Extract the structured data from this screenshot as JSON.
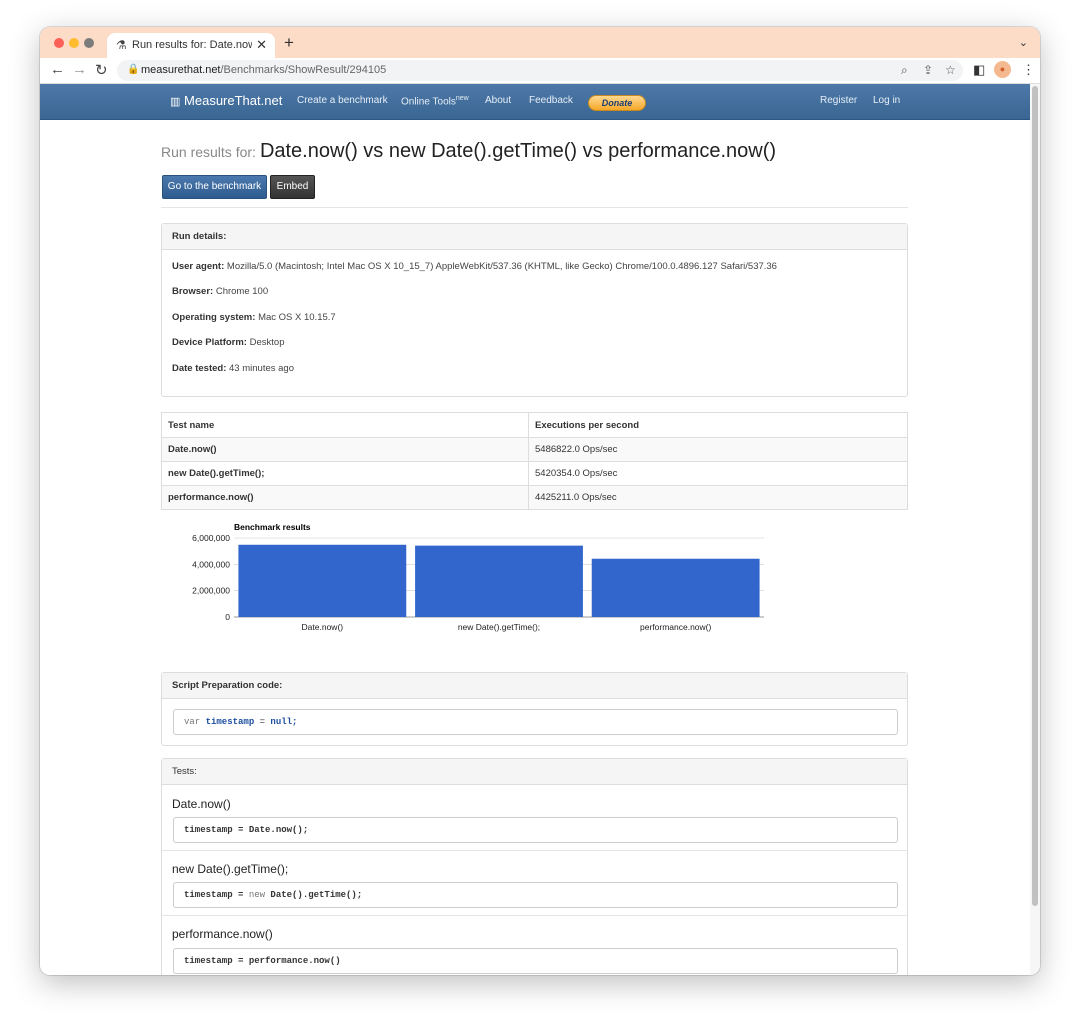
{
  "browser": {
    "tab_title": "Run results for: Date.now() vs n",
    "url_domain": "measurethat.net",
    "url_path": "/Benchmarks/ShowResult/294105"
  },
  "nav": {
    "brand": "MeasureThat.net",
    "links": [
      "Create a benchmark",
      "Online Tools",
      "About",
      "Feedback"
    ],
    "online_tools_sup": "new",
    "donate": "Donate",
    "register": "Register",
    "login": "Log in"
  },
  "page": {
    "title_prefix": "Run results for:",
    "title": "Date.now() vs new Date().getTime() vs performance.now()",
    "btn_goto": "Go to the benchmark",
    "btn_embed": "Embed"
  },
  "run_details": {
    "heading": "Run details:",
    "user_agent_label": "User agent:",
    "user_agent": "Mozilla/5.0 (Macintosh; Intel Mac OS X 10_15_7) AppleWebKit/537.36 (KHTML, like Gecko) Chrome/100.0.4896.127 Safari/537.36",
    "browser_label": "Browser:",
    "browser": "Chrome 100",
    "os_label": "Operating system:",
    "os": "Mac OS X 10.15.7",
    "platform_label": "Device Platform:",
    "platform": "Desktop",
    "date_label": "Date tested:",
    "date": "43 minutes ago"
  },
  "results": {
    "col_name": "Test name",
    "col_ops": "Executions per second",
    "rows": [
      {
        "name": "Date.now()",
        "ops": "5486822.0 Ops/sec"
      },
      {
        "name": "new Date().getTime();",
        "ops": "5420354.0 Ops/sec"
      },
      {
        "name": "performance.now()",
        "ops": "4425211.0 Ops/sec"
      }
    ]
  },
  "chart_data": {
    "type": "bar",
    "title": "Benchmark results",
    "categories": [
      "Date.now()",
      "new Date().getTime();",
      "performance.now()"
    ],
    "values": [
      5486822,
      5420354,
      4425211
    ],
    "yticks": [
      "0",
      "2,000,000",
      "4,000,000",
      "6,000,000"
    ],
    "ylim": [
      0,
      6000000
    ],
    "xlabel": "",
    "ylabel": "",
    "bar_color": "#3366cc",
    "grid": true,
    "legend": "none"
  },
  "prep": {
    "heading": "Script Preparation code:",
    "code_kw": "var",
    "code_var": "timestamp",
    "code_eq": " = ",
    "code_val": "null;"
  },
  "tests": {
    "heading": "Tests:",
    "items": [
      {
        "name": "Date.now()",
        "lhs": "timestamp = ",
        "kw": "",
        "rest": "Date.now();"
      },
      {
        "name": "new Date().getTime();",
        "lhs": "timestamp = ",
        "kw": "new ",
        "rest": "Date().getTime();"
      },
      {
        "name": "performance.now()",
        "lhs": "timestamp = ",
        "kw": "",
        "rest": "performance.now()"
      }
    ]
  }
}
